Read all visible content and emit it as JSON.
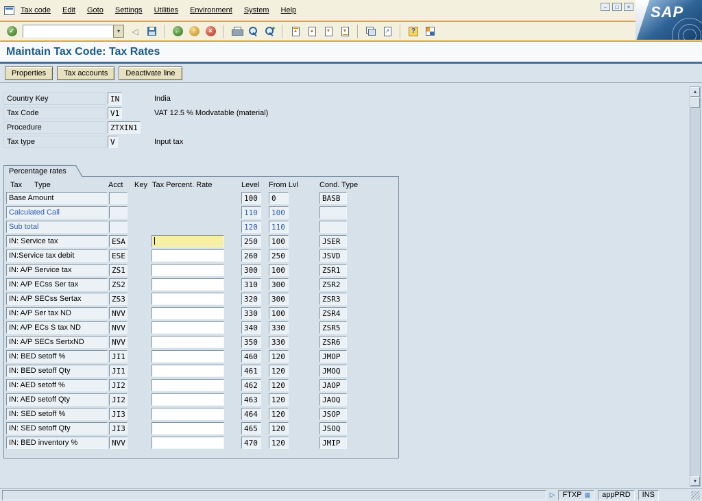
{
  "window": {
    "menu_items": [
      "Tax code",
      "Edit",
      "Goto",
      "Settings",
      "Utilities",
      "Environment",
      "System",
      "Help"
    ],
    "controls": {
      "minimize": "–",
      "maximize": "□",
      "close": "×"
    },
    "logo_text": "SAP"
  },
  "toolbar": {
    "command_value": ""
  },
  "page": {
    "title": "Maintain Tax Code: Tax Rates"
  },
  "app_toolbar": {
    "buttons": [
      "Properties",
      "Tax accounts",
      "Deactivate line"
    ]
  },
  "header_fields": [
    {
      "label": "Country Key",
      "value": "IN",
      "desc": "India"
    },
    {
      "label": "Tax Code",
      "value": "V1",
      "desc": "VAT 12.5 % Modvatable (material)"
    },
    {
      "label": "Procedure",
      "value": "ZTXIN1",
      "desc": ""
    },
    {
      "label": "Tax type",
      "value": "V",
      "desc": "Input tax"
    }
  ],
  "percentage_rates": {
    "tab_label": "Percentage rates",
    "headers": {
      "tax": "Tax",
      "type": "Type",
      "acct": "Acct",
      "key": "Key",
      "rate": "Tax Percent. Rate",
      "level": "Level",
      "from": "From Lvl",
      "cond": "Cond. Type"
    },
    "rows": [
      {
        "tax_type": "Base Amount",
        "acct": "",
        "has_rate": false,
        "rate": "",
        "focused": false,
        "level": "100",
        "from": "0",
        "cond": "BASB",
        "link": false
      },
      {
        "tax_type": "Calculated Call",
        "acct": "",
        "has_rate": false,
        "rate": "",
        "focused": false,
        "level": "110",
        "from": "100",
        "cond": "",
        "link": true
      },
      {
        "tax_type": "Sub total",
        "acct": "",
        "has_rate": false,
        "rate": "",
        "focused": false,
        "level": "120",
        "from": "110",
        "cond": "",
        "link": true
      },
      {
        "tax_type": "IN: Service tax",
        "acct": "ESA",
        "has_rate": true,
        "rate": "",
        "focused": true,
        "level": "250",
        "from": "100",
        "cond": "JSER",
        "link": false
      },
      {
        "tax_type": "IN:Service tax debit",
        "acct": "ESE",
        "has_rate": true,
        "rate": "",
        "focused": false,
        "level": "260",
        "from": "250",
        "cond": "JSVD",
        "link": false
      },
      {
        "tax_type": "IN: A/P Service tax",
        "acct": "ZS1",
        "has_rate": true,
        "rate": "",
        "focused": false,
        "level": "300",
        "from": "100",
        "cond": "ZSR1",
        "link": false
      },
      {
        "tax_type": "IN: A/P ECss Ser tax",
        "acct": "ZS2",
        "has_rate": true,
        "rate": "",
        "focused": false,
        "level": "310",
        "from": "300",
        "cond": "ZSR2",
        "link": false
      },
      {
        "tax_type": "IN: A/P SECss Sertax",
        "acct": "ZS3",
        "has_rate": true,
        "rate": "",
        "focused": false,
        "level": "320",
        "from": "300",
        "cond": "ZSR3",
        "link": false
      },
      {
        "tax_type": "IN: A/P Ser tax ND",
        "acct": "NVV",
        "has_rate": true,
        "rate": "",
        "focused": false,
        "level": "330",
        "from": "100",
        "cond": "ZSR4",
        "link": false
      },
      {
        "tax_type": "IN: A/P ECs S tax ND",
        "acct": "NVV",
        "has_rate": true,
        "rate": "",
        "focused": false,
        "level": "340",
        "from": "330",
        "cond": "ZSR5",
        "link": false
      },
      {
        "tax_type": "IN: A/P SECs SertxND",
        "acct": "NVV",
        "has_rate": true,
        "rate": "",
        "focused": false,
        "level": "350",
        "from": "330",
        "cond": "ZSR6",
        "link": false
      },
      {
        "tax_type": "IN: BED setoff %",
        "acct": "JI1",
        "has_rate": true,
        "rate": "",
        "focused": false,
        "level": "460",
        "from": "120",
        "cond": "JMOP",
        "link": false
      },
      {
        "tax_type": "IN: BED setoff Qty",
        "acct": "JI1",
        "has_rate": true,
        "rate": "",
        "focused": false,
        "level": "461",
        "from": "120",
        "cond": "JMOQ",
        "link": false
      },
      {
        "tax_type": "IN: AED setoff %",
        "acct": "JI2",
        "has_rate": true,
        "rate": "",
        "focused": false,
        "level": "462",
        "from": "120",
        "cond": "JAOP",
        "link": false
      },
      {
        "tax_type": "IN: AED setoff Qty",
        "acct": "JI2",
        "has_rate": true,
        "rate": "",
        "focused": false,
        "level": "463",
        "from": "120",
        "cond": "JAOQ",
        "link": false
      },
      {
        "tax_type": "IN: SED setoff %",
        "acct": "JI3",
        "has_rate": true,
        "rate": "",
        "focused": false,
        "level": "464",
        "from": "120",
        "cond": "JSOP",
        "link": false
      },
      {
        "tax_type": "IN: SED setoff Qty",
        "acct": "JI3",
        "has_rate": true,
        "rate": "",
        "focused": false,
        "level": "465",
        "from": "120",
        "cond": "JSOQ",
        "link": false
      },
      {
        "tax_type": "IN: BED inventory %",
        "acct": "NVV",
        "has_rate": true,
        "rate": "",
        "focused": false,
        "level": "470",
        "from": "120",
        "cond": "JMIP",
        "link": false
      }
    ]
  },
  "status_bar": {
    "message": "",
    "transaction": "FTXP",
    "server": "appPRD",
    "mode": "INS"
  },
  "icons": {
    "enter_check": "✓",
    "dropdown": "▾",
    "enter": "◁",
    "back": "←",
    "exit": "↑",
    "cancel": "×",
    "find_next_plus": "+",
    "page_up": "▲",
    "page_down": "▼",
    "shortcut_arrow": "↗",
    "help": "?",
    "scroll_up": "▲",
    "scroll_down": "▼",
    "status_arrow": "▷",
    "transaction_icon": "▦"
  },
  "colors": {
    "accent_gold": "#e0a43c",
    "link": "#2a5db0",
    "focus_bg": "#f7f0a4",
    "title_text": "#1b5a8a",
    "logo_blue": "#2f6396"
  }
}
